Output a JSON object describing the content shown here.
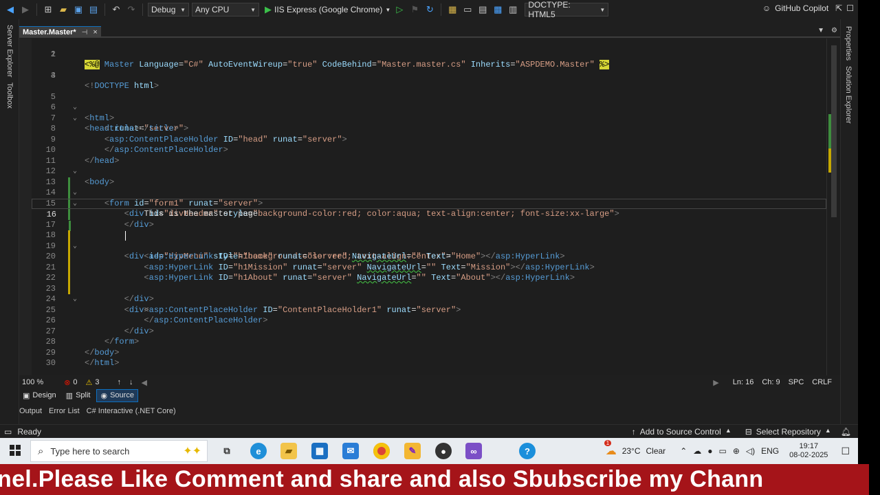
{
  "toolbar": {
    "config": "Debug",
    "platform": "Any CPU",
    "run_target": "IIS Express (Google Chrome)",
    "doctype": "DOCTYPE: HTML5",
    "copilot": "GitHub Copilot"
  },
  "left_tools": {
    "server_explorer": "Server Explorer",
    "toolbox": "Toolbox"
  },
  "right_tools": {
    "properties": "Properties",
    "solution_explorer": "Solution Explorer"
  },
  "tab": {
    "title": "Master.Master*",
    "pin": "⊣",
    "close": "×"
  },
  "editor": {
    "lines": [
      {
        "n": "1"
      },
      {
        "n": "2"
      },
      {
        "n": "3"
      },
      {
        "n": "4"
      },
      {
        "n": "5"
      },
      {
        "n": "6"
      },
      {
        "n": "7"
      },
      {
        "n": "8"
      },
      {
        "n": "9"
      },
      {
        "n": "10"
      },
      {
        "n": "11"
      },
      {
        "n": "12"
      },
      {
        "n": "13"
      },
      {
        "n": "14"
      },
      {
        "n": "15"
      },
      {
        "n": "16"
      },
      {
        "n": "17"
      },
      {
        "n": "18"
      },
      {
        "n": "19"
      },
      {
        "n": "20"
      },
      {
        "n": "21"
      },
      {
        "n": "22"
      },
      {
        "n": "23"
      },
      {
        "n": "24"
      },
      {
        "n": "25"
      },
      {
        "n": "26"
      },
      {
        "n": "27"
      },
      {
        "n": "28"
      },
      {
        "n": "29"
      },
      {
        "n": "30"
      }
    ],
    "code": {
      "l1_a": "<%@",
      "l1_b": " Master ",
      "l1_c": "Language",
      "l1_d": "=",
      "l1_e": "\"C#\"",
      "l1_f": " AutoEventWireup",
      "l1_g": "\"true\"",
      "l1_h": " CodeBehind",
      "l1_i": "\"Master.master.cs\"",
      "l1_j": " Inherits",
      "l1_k": "\"ASPDEMO.Master\"",
      "l1_l": "%>",
      "l3_a": "<!",
      "l3_b": "DOCTYPE",
      "l3_c": " html",
      "l3_d": ">",
      "l14_text": "This is the master page",
      "l13_style": "\"background-color:red; color:aqua; text-align:center; font-size:xx-large\"",
      "l17_style": "\"background-color:red; text-align:center\""
    }
  },
  "editor_status": {
    "zoom": "100 %",
    "errors": "0",
    "warnings": "3",
    "ln": "Ln: 16",
    "ch": "Ch: 9",
    "spc": "SPC",
    "crlf": "CRLF"
  },
  "view_tabs": {
    "design": "Design",
    "split": "Split",
    "source": "Source"
  },
  "panel_tabs": {
    "output": "Output",
    "error_list": "Error List",
    "csi": "C# Interactive (.NET Core)"
  },
  "statusbar": {
    "ready": "Ready",
    "add_source": "Add to Source Control",
    "select_repo": "Select Repository"
  },
  "taskbar": {
    "search_placeholder": "Type here to search",
    "weather_temp": "23°C",
    "weather_text": "Clear",
    "lang": "ENG",
    "time": "19:17",
    "date": "08-02-2025",
    "weather_badge": "1"
  },
  "banner": {
    "text": "nel.Please Like Comment and share and also Sbubscribe my Chann"
  },
  "colors": {
    "accent": "#0e70c0",
    "banner": "#a51419",
    "added": "#3e8e3e",
    "modified": "#c6a800"
  }
}
